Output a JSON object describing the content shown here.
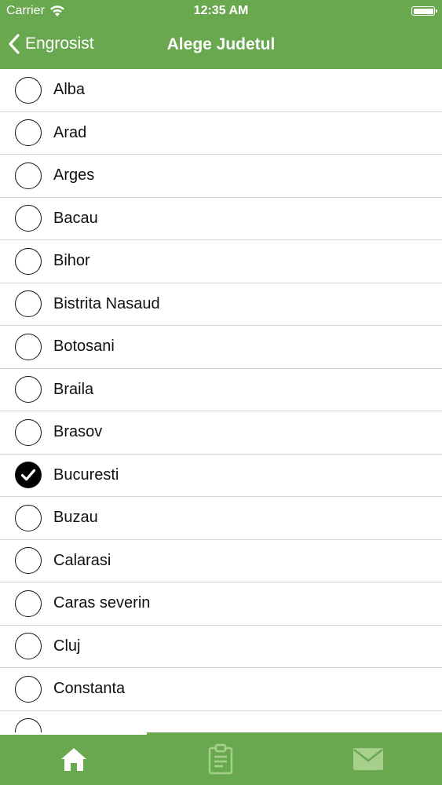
{
  "status_bar": {
    "carrier": "Carrier",
    "time": "12:35 AM"
  },
  "nav": {
    "back_label": "Engrosist",
    "title": "Alege Judetul"
  },
  "counties": [
    {
      "label": "Alba",
      "selected": false
    },
    {
      "label": "Arad",
      "selected": false
    },
    {
      "label": "Arges",
      "selected": false
    },
    {
      "label": "Bacau",
      "selected": false
    },
    {
      "label": "Bihor",
      "selected": false
    },
    {
      "label": "Bistrita Nasaud",
      "selected": false
    },
    {
      "label": "Botosani",
      "selected": false
    },
    {
      "label": "Braila",
      "selected": false
    },
    {
      "label": "Brasov",
      "selected": false
    },
    {
      "label": "Bucuresti",
      "selected": true
    },
    {
      "label": "Buzau",
      "selected": false
    },
    {
      "label": "Calarasi",
      "selected": false
    },
    {
      "label": "Caras severin",
      "selected": false
    },
    {
      "label": "Cluj",
      "selected": false
    },
    {
      "label": "Constanta",
      "selected": false
    },
    {
      "label": "",
      "selected": false
    }
  ],
  "tab_bar": {
    "active_tab": "home",
    "tabs": [
      {
        "icon": "home-icon",
        "active": true
      },
      {
        "icon": "clipboard-icon",
        "active": false
      },
      {
        "icon": "mail-icon",
        "active": false
      }
    ]
  },
  "colors": {
    "brand_green": "#6aa84f",
    "tab_inactive_icon": "#a8d08d",
    "divider": "#d4d4d4"
  }
}
